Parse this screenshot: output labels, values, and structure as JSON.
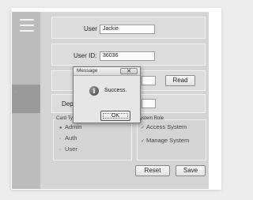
{
  "form": {
    "user_label": "User",
    "user_value": "Jackie",
    "user_id_label": "User ID:",
    "user_id_value": "36036",
    "read_button": "Read",
    "dep_label": "Dep",
    "card_type": {
      "title": "Card Ty",
      "options": [
        {
          "label": "Admin",
          "selected": true
        },
        {
          "label": "Auth",
          "selected": false
        },
        {
          "label": "User",
          "selected": false
        }
      ]
    },
    "system_role": {
      "title": "ystem Role",
      "options": [
        {
          "label": "Access System",
          "checked": true
        },
        {
          "label": "Manage System",
          "checked": true
        }
      ]
    },
    "reset_button": "Reset",
    "save_button": "Save"
  },
  "dialog": {
    "title": "Message",
    "close_glyph": "✕",
    "icon_glyph": "i",
    "message": "Success.",
    "ok_button": "OK"
  },
  "colors": {
    "sidebar": "#bcbcbc",
    "sidebar_active": "#9a9a9a",
    "panel": "#d4d4d4"
  },
  "icons": [
    "hamburger-menu-icon",
    "info-icon",
    "close-icon",
    "radio-dot-icon",
    "checkmark-icon"
  ]
}
